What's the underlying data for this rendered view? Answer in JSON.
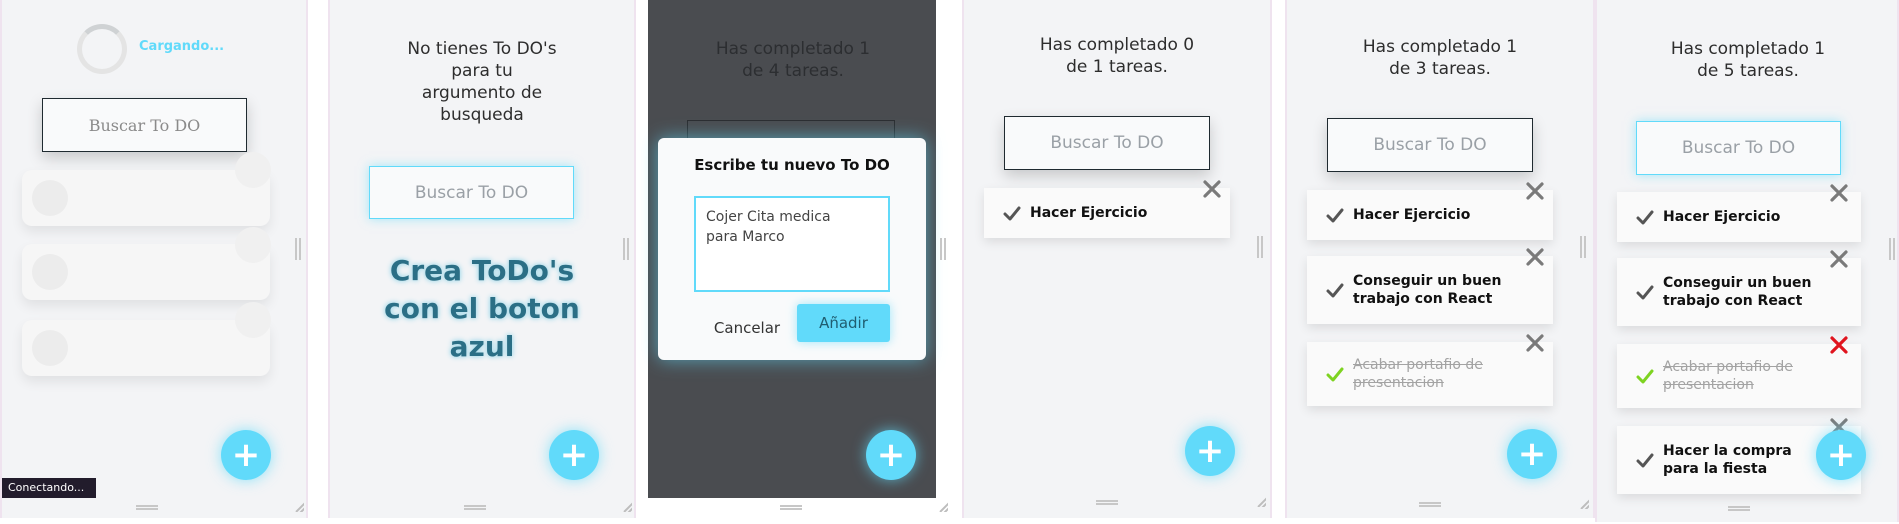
{
  "loading": {
    "spinner_text": "Cargando...",
    "search_placeholder": "Buscar To DO",
    "status_tooltip": "Conectando..."
  },
  "empty": {
    "title": "No tienes To DO's\npara tu\nargumento de\nbusqueda",
    "search_placeholder": "Buscar To DO",
    "create_hint": "Crea ToDo's\ncon el boton\nazul"
  },
  "modal": {
    "bg_title": "Has completado 1\nde 4 tareas.",
    "heading": "Escribe tu nuevo To DO",
    "textarea_value": "Cojer Cita medica\npara Marco",
    "cancel_label": "Cancelar",
    "add_label": "Añadir"
  },
  "panel4": {
    "title": "Has completado 0\nde 1 tareas.",
    "search_placeholder": "Buscar To DO",
    "todos": [
      {
        "text": "Hacer Ejercicio",
        "completed": false
      }
    ]
  },
  "panel5": {
    "title": "Has completado 1\nde 3 tareas.",
    "search_placeholder": "Buscar To DO",
    "todos": [
      {
        "text": "Hacer Ejercicio",
        "completed": false
      },
      {
        "text": "Conseguir un buen\ntrabajo con React",
        "completed": false
      },
      {
        "text": "Acabar portafio de\npresentacion",
        "completed": true
      }
    ]
  },
  "panel6": {
    "title": "Has completado 1\nde 5 tareas.",
    "search_placeholder": "Buscar To DO",
    "todos": [
      {
        "text": "Hacer Ejercicio",
        "completed": false
      },
      {
        "text": "Conseguir un buen\ntrabajo con React",
        "completed": false
      },
      {
        "text": "Acabar portafio de\npresentacion",
        "completed": true
      },
      {
        "text": "Hacer la compra\npara la fiesta",
        "completed": false
      }
    ]
  },
  "fab_label": "+",
  "colors": {
    "accent": "#61dafa",
    "check_done": "#7ed321",
    "check_pending": "#555555",
    "delete_gray": "#7a7a7a",
    "delete_red": "#e0141e",
    "hint_text": "#2b6f86",
    "overlay": "#4a4c50"
  }
}
